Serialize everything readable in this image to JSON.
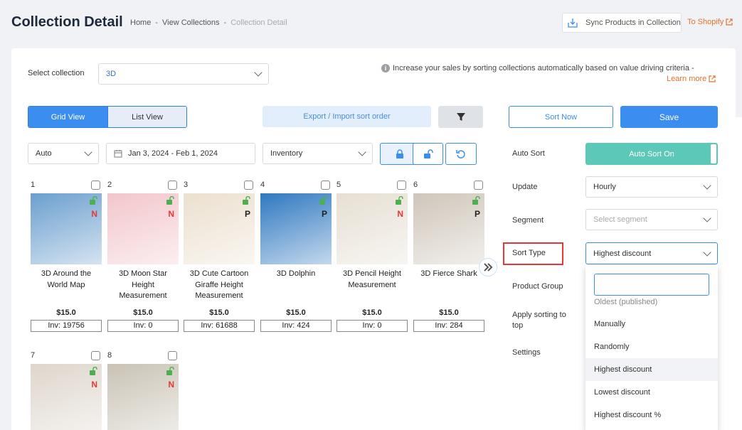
{
  "header": {
    "title": "Collection Detail",
    "breadcrumb": [
      "Home",
      "View Collections",
      "Collection Detail"
    ],
    "breadcrumb_sep": "-",
    "sync_label": "Sync Products in Collection",
    "shopify_label": "To Shopify"
  },
  "controls": {
    "select_collection_label": "Select collection",
    "collection_value": "3D",
    "info_text": "Increase your sales by sorting collections automatically based on value driving criteria -",
    "learn_more": "Learn more",
    "grid_view": "Grid View",
    "list_view": "List View",
    "export_label": "Export / Import sort order",
    "sort_now": "Sort Now",
    "save": "Save",
    "auto_value": "Auto",
    "date_range": "Jan 3, 2024 - Feb 1, 2024",
    "metric_value": "Inventory"
  },
  "products": [
    {
      "num": "1",
      "name": "3D Around the World Map",
      "price": "$15.0",
      "inv": "Inv: 19756",
      "badge": "N",
      "badge_color": "#e53935",
      "bg": "#6b9fce"
    },
    {
      "num": "2",
      "name": "3D Moon Star Height Measurement",
      "price": "$15.0",
      "inv": "Inv: 0",
      "badge": "N",
      "badge_color": "#e53935",
      "bg": "#f2c6cb"
    },
    {
      "num": "3",
      "name": "3D Cute Cartoon Giraffe Height Measurement",
      "price": "$15.0",
      "inv": "Inv: 61688",
      "badge": "P",
      "badge_color": "#222",
      "bg": "#ece0cf"
    },
    {
      "num": "4",
      "name": "3D Dolphin",
      "price": "$15.0",
      "inv": "Inv: 424",
      "badge": "P",
      "badge_color": "#222",
      "bg": "#2f78c0"
    },
    {
      "num": "5",
      "name": "3D Pencil Height Measurement",
      "price": "$15.0",
      "inv": "Inv: 0",
      "badge": "N",
      "badge_color": "#e53935",
      "bg": "#e6dfd3"
    },
    {
      "num": "6",
      "name": "3D Fierce Shark",
      "price": "$15.0",
      "inv": "Inv: 284",
      "badge": "P",
      "badge_color": "#222",
      "bg": "#cfc6ba"
    },
    {
      "num": "7",
      "name": "",
      "price": "",
      "inv": "",
      "badge": "N",
      "badge_color": "#e53935",
      "bg": "#ded6cc"
    },
    {
      "num": "8",
      "name": "",
      "price": "",
      "inv": "",
      "badge": "N",
      "badge_color": "#e53935",
      "bg": "#c9c3b5"
    }
  ],
  "settings": {
    "auto_sort_label": "Auto Sort",
    "auto_sort_value": "Auto Sort On",
    "update_label": "Update",
    "update_value": "Hourly",
    "segment_label": "Segment",
    "segment_placeholder": "Select segment",
    "sort_type_label": "Sort Type",
    "sort_type_value": "Highest discount",
    "product_group_label": "Product Group",
    "apply_sorting_label": "Apply sorting to top",
    "settings_label": "Settings"
  },
  "dropdown": {
    "partial_item": "Oldest (published)",
    "items": [
      "Manually",
      "Randomly",
      "Highest discount",
      "Lowest discount",
      "Highest discount %"
    ],
    "selected": "Highest discount"
  },
  "colors": {
    "primary": "#3b8ef0",
    "accent_orange": "#e5732b",
    "auto_sort_green": "#5cc8b8",
    "highlight_red": "#e53935"
  }
}
